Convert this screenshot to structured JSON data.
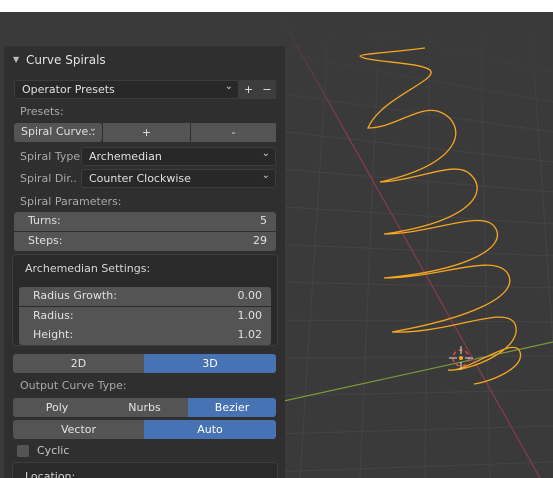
{
  "panel": {
    "title": "Curve Spirals",
    "operator_presets": "Operator Presets",
    "plus": "+",
    "minus": "−",
    "presets_label": "Presets:",
    "spiral_preset": "Spiral Curve..",
    "preset_add": "+",
    "preset_remove": "-",
    "spiral_type_label": "Spiral Type:",
    "spiral_type_value": "Archemedian",
    "spiral_dir_label": "Spiral Dir..",
    "spiral_dir_value": "Counter Clockwise",
    "spiral_params_label": "Spiral Parameters:",
    "turns_label": "Turns:",
    "turns_value": "5",
    "steps_label": "Steps:",
    "steps_value": "29",
    "arch_settings_label": "Archemedian Settings:",
    "radius_growth_label": "Radius Growth:",
    "radius_growth_value": "0.00",
    "radius_label": "Radius:",
    "radius_value": "1.00",
    "height_label": "Height:",
    "height_value": "1.02",
    "mode_2d": "2D",
    "mode_3d": "3D",
    "output_curve_type_label": "Output Curve Type:",
    "curve_poly": "Poly",
    "curve_nurbs": "Nurbs",
    "curve_bezier": "Bezier",
    "handle_vector": "Vector",
    "handle_auto": "Auto",
    "cyclic_label": "Cyclic",
    "location_label": "Location:"
  },
  "colors": {
    "accent": "#4772b3",
    "spiral": "#f5a623",
    "x_axis": "#8a3a4a",
    "y_axis": "#7a9a3a"
  }
}
